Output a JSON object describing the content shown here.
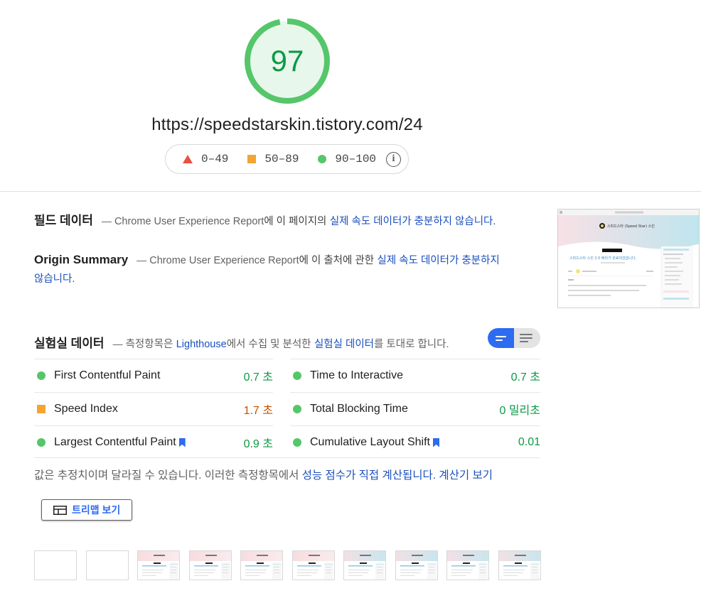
{
  "score": {
    "value": "97",
    "color": "#0cce6b",
    "track": "#e5f8ec"
  },
  "url": "https://speedstarskin.tistory.com/24",
  "legend": {
    "fail": "0–49",
    "average": "50–89",
    "pass": "90–100",
    "info_glyph": "i"
  },
  "field_data": {
    "title": "필드 데이터",
    "dash": "—",
    "source": "Chrome User Experience Report",
    "mid": "에 이 페이지의",
    "link": "실제 속도 데이터가 충분하지 않습니다",
    "end": "."
  },
  "origin_summary": {
    "title": "Origin Summary",
    "dash": "—",
    "source": "Chrome User Experience Report",
    "mid": "에 이 출처에 관한",
    "link": "실제 속도 데이터가 충분하지 않습니다",
    "end": "."
  },
  "lab_data": {
    "title": "실험실 데이터",
    "dash": "—",
    "pre": "측정항목은",
    "tool": "Lighthouse",
    "mid": "에서 수집 및 분석한",
    "link": "실험실 데이터",
    "end": "를 토대로 합니다."
  },
  "metrics": {
    "fcp": {
      "name": "First Contentful Paint",
      "value": "0.7 초",
      "rating": "good"
    },
    "tti": {
      "name": "Time to Interactive",
      "value": "0.7 초",
      "rating": "good"
    },
    "si": {
      "name": "Speed Index",
      "value": "1.7 초",
      "rating": "average"
    },
    "tbt": {
      "name": "Total Blocking Time",
      "value": "0 밀리초",
      "rating": "good"
    },
    "lcp": {
      "name": "Largest Contentful Paint",
      "value": "0.9 초",
      "rating": "good"
    },
    "cls": {
      "name": "Cumulative Layout Shift",
      "value": "0.01",
      "rating": "good"
    }
  },
  "note": {
    "text": "값은 추정치이며 달라질 수 있습니다. 이러한 측정항목에서",
    "link1": "성능 점수가 직접 계산됩니다",
    "dot": ".",
    "link2": "계산기 보기"
  },
  "treemap_button": "트리맵 보기",
  "screenshot": {
    "site_title": "스피드스타 (Speed Star) 스킨",
    "headline": "스피드스타 스킨 2.0 베타가 완료되었습니다."
  },
  "filmstrip_frames": [
    "blank",
    "blank",
    "pink",
    "pink",
    "pink",
    "pink",
    "blue",
    "blue",
    "blue",
    "blue"
  ],
  "colors": {
    "good": "#0c9a45",
    "average": "#c64e00",
    "link": "#1a4fbd",
    "accent": "#2d6bf0"
  }
}
